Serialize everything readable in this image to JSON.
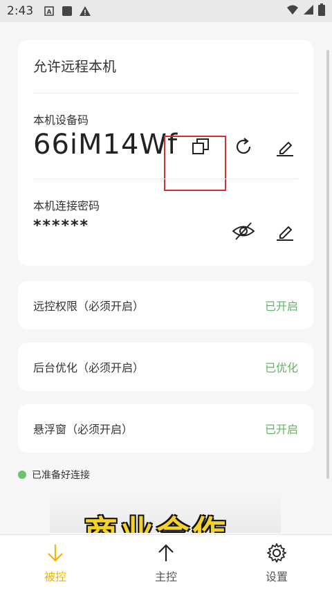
{
  "status_bar": {
    "time": "2:43",
    "icons": [
      "notification-a-icon",
      "square-icon",
      "warning-icon"
    ],
    "right_icons": [
      "wifi-icon",
      "cell-signal-icon",
      "battery-icon"
    ]
  },
  "main_card": {
    "title": "允许远程本机",
    "device_code_label": "本机设备码",
    "device_code": "66iM14Wf",
    "password_label": "本机连接密码",
    "password": "******"
  },
  "settings_rows": [
    {
      "label": "远控权限（必须开启）",
      "status": "已开启"
    },
    {
      "label": "后台优化（必须开启）",
      "status": "已优化"
    },
    {
      "label": "悬浮窗（必须开启）",
      "status": "已开启"
    }
  ],
  "ready_text": "已准备好连接",
  "banner_text": "商业合作",
  "bottom_nav": [
    {
      "label": "被控",
      "icon": "arrow-down-icon",
      "active": true
    },
    {
      "label": "主控",
      "icon": "arrow-up-icon",
      "active": false
    },
    {
      "label": "设置",
      "icon": "gear-icon",
      "active": false
    }
  ],
  "colors": {
    "accent": "#f0b400",
    "status_green": "#5cb85c",
    "highlight": "#d32f2f"
  }
}
